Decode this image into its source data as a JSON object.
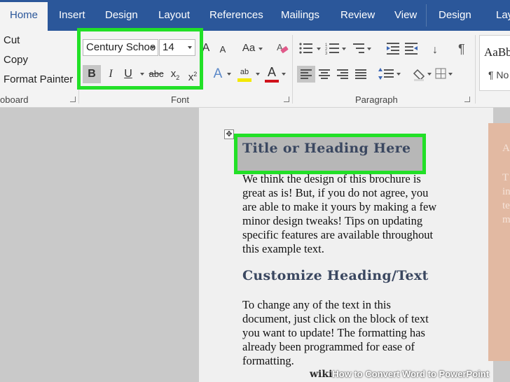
{
  "tabs": [
    {
      "label": "Home"
    },
    {
      "label": "Insert"
    },
    {
      "label": "Design"
    },
    {
      "label": "Layout"
    },
    {
      "label": "References"
    },
    {
      "label": "Mailings"
    },
    {
      "label": "Review"
    },
    {
      "label": "View"
    },
    {
      "label": "Design"
    },
    {
      "label": "Layo"
    }
  ],
  "clipboard": {
    "cut": "Cut",
    "copy": "Copy",
    "format_painter": "Format Painter",
    "group_label": "oboard"
  },
  "font": {
    "family": "Century Schoo",
    "size": "14",
    "group_label": "Font",
    "grow": "A",
    "shrink": "A",
    "change_case": "Aa",
    "bold": "B",
    "italic": "I",
    "underline": "U",
    "strike": "abc",
    "subscript": "x",
    "subscript_mark": "2",
    "superscript": "x",
    "superscript_mark": "2",
    "text_effects": "A",
    "highlight": "ab",
    "font_color": "A"
  },
  "paragraph": {
    "group_label": "Paragraph"
  },
  "styles": {
    "preview": "AaBb",
    "name": "¶ No"
  },
  "document": {
    "heading1": "Title or Heading Here",
    "para1": "We think the design of this brochure is\ngreat as is!  But, if you do not agree, you\nare able to make it yours by making a few\nminor design tweaks!  Tips on updating\nspecific features are available throughout\nthis example text.",
    "heading2": "Customize Heading/Text",
    "para2": "To change any of the text in this\ndocument, just click on the block of text\nyou want to update!  The formatting has\nalready been programmed for ease of\nformatting.",
    "side_letters": [
      "A",
      "T",
      "in",
      "te",
      "m"
    ]
  },
  "watermark": {
    "site": "wiki",
    "caption": "How to Convert Word to PowerPoint"
  },
  "colors": {
    "tab_blue": "#2b579a",
    "highlight_green": "#22e027",
    "highlight_yellow": "#f3e800",
    "font_red": "#d0121b"
  }
}
